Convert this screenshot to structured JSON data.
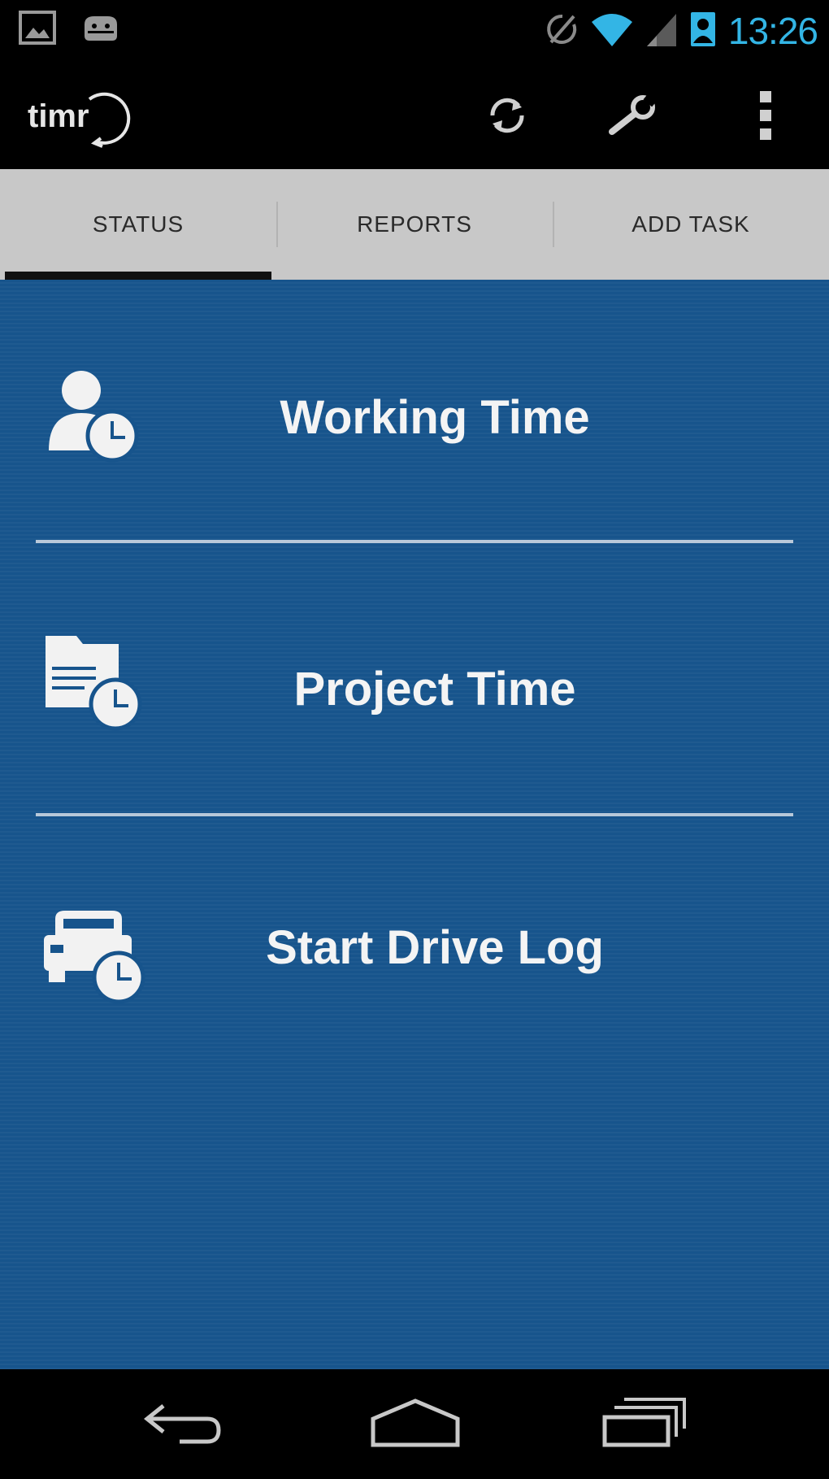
{
  "status_bar": {
    "left_icons": [
      "image-icon",
      "android-debug-icon"
    ],
    "right_icons": [
      "sync-disabled-icon",
      "wifi-icon",
      "signal-icon",
      "contact-icon"
    ],
    "time": "13:26",
    "time_color": "#33b5e5"
  },
  "action_bar": {
    "logo_text": "timr",
    "buttons": [
      "refresh-icon",
      "wrench-icon",
      "overflow-menu-icon"
    ]
  },
  "tabs": [
    {
      "label": "STATUS",
      "active": true
    },
    {
      "label": "REPORTS",
      "active": false
    },
    {
      "label": "ADD TASK",
      "active": false
    }
  ],
  "main": {
    "background_color": "#17548c",
    "items": [
      {
        "label": "Working Time",
        "icon": "person-clock-icon"
      },
      {
        "label": "Project Time",
        "icon": "folder-clock-icon"
      },
      {
        "label": "Start Drive Log",
        "icon": "car-clock-icon"
      }
    ]
  },
  "nav_bar": {
    "buttons": [
      "back-icon",
      "home-icon",
      "recent-apps-icon"
    ]
  }
}
